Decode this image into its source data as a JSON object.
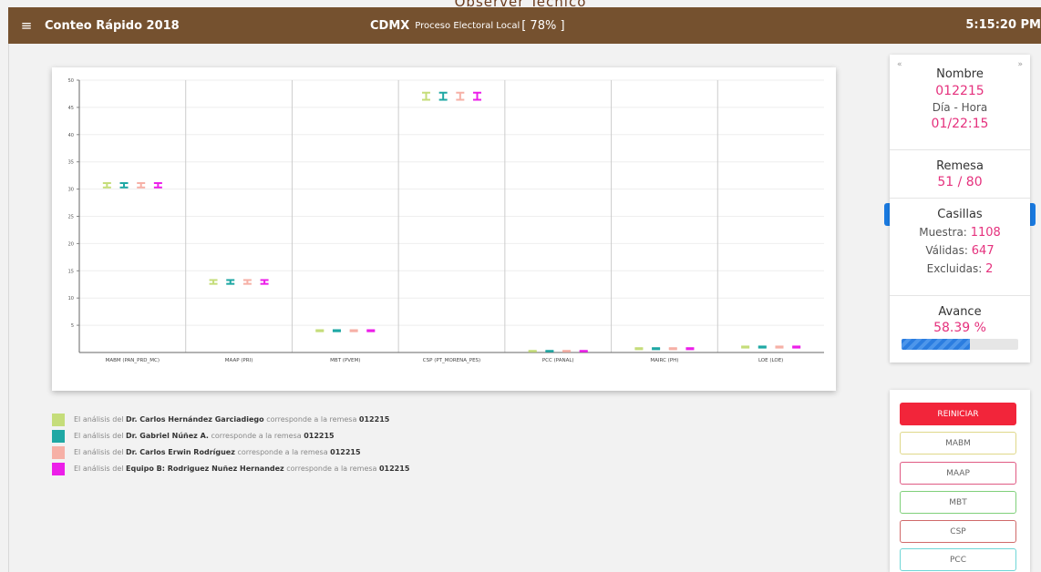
{
  "header": {
    "overhead_title": "Observer Técnico",
    "app_title": "Conteo Rápido 2018",
    "state": "CDMX",
    "process": "Proceso Electoral Local",
    "percent": "[ 78% ]",
    "clock": "5:15:20 PM"
  },
  "colors": {
    "header_bg": "#75512f",
    "accent": "#e5317d",
    "reset": "#f2253a",
    "progress": "#2b7de0"
  },
  "chart_data": {
    "type": "errorbar",
    "categories": [
      "MABM (PAN_PRD_MC)",
      "MAAP (PRI)",
      "MBT (PVEM)",
      "CSP (PT_MORENA_PES)",
      "PCC (PANAL)",
      "MAIRC (PH)",
      "LOE (LOE)"
    ],
    "yticks": [
      5,
      10,
      15,
      20,
      25,
      30,
      35,
      40,
      45,
      50
    ],
    "ylim": [
      0,
      50
    ],
    "grid": true,
    "series": [
      {
        "color": "#c5dd7a",
        "values": [
          [
            30.3,
            31.1
          ],
          [
            12.6,
            13.3
          ],
          [
            3.9,
            4.1
          ],
          [
            46.4,
            47.7
          ],
          [
            0.2,
            0.3
          ],
          [
            0.6,
            0.8
          ],
          [
            0.9,
            1.1
          ]
        ]
      },
      {
        "color": "#1fa8a4",
        "values": [
          [
            30.3,
            31.1
          ],
          [
            12.6,
            13.3
          ],
          [
            3.9,
            4.1
          ],
          [
            46.4,
            47.7
          ],
          [
            0.2,
            0.3
          ],
          [
            0.6,
            0.8
          ],
          [
            0.9,
            1.1
          ]
        ]
      },
      {
        "color": "#f6b0a6",
        "values": [
          [
            30.3,
            31.1
          ],
          [
            12.6,
            13.3
          ],
          [
            3.9,
            4.1
          ],
          [
            46.4,
            47.7
          ],
          [
            0.2,
            0.3
          ],
          [
            0.6,
            0.8
          ],
          [
            0.9,
            1.1
          ]
        ]
      },
      {
        "color": "#ec1fe9",
        "values": [
          [
            30.3,
            31.1
          ],
          [
            12.6,
            13.3
          ],
          [
            3.9,
            4.1
          ],
          [
            46.4,
            47.7
          ],
          [
            0.2,
            0.3
          ],
          [
            0.6,
            0.8
          ],
          [
            0.9,
            1.1
          ]
        ]
      }
    ]
  },
  "legend": [
    {
      "color": "#c5dd7a",
      "prefix": "El análisis del",
      "name": "Dr. Carlos Hernández Garciadiego",
      "middle": "corresponde a la remesa",
      "remesa": "012215"
    },
    {
      "color": "#1fa8a4",
      "prefix": "El análisis del",
      "name": "Dr. Gabriel Núñez A.",
      "middle": "corresponde a la remesa",
      "remesa": "012215"
    },
    {
      "color": "#f6b0a6",
      "prefix": "El análisis del",
      "name": "Dr. Carlos Erwin Rodríguez",
      "middle": "corresponde a la remesa",
      "remesa": "012215"
    },
    {
      "color": "#ec1fe9",
      "prefix": "El análisis del",
      "name": "Equipo B: Rodriguez Nuñez Hernandez",
      "middle": "corresponde a la remesa",
      "remesa": "012215"
    }
  ],
  "info": {
    "prev_glyph": "«",
    "next_glyph": "»",
    "nombre_label": "Nombre",
    "nombre_value": "012215",
    "dia_label": "Día - Hora",
    "dia_value": "01/22:15",
    "remesa_label": "Remesa",
    "remesa_value": "51 / 80",
    "casillas_label": "Casillas",
    "muestra_label": "Muestra:",
    "muestra_value": "1108",
    "validas_label": "Válidas:",
    "validas_value": "647",
    "excluidas_label": "Excluidas:",
    "excluidas_value": "2",
    "avance_label": "Avance",
    "avance_value": "58.39 %",
    "avance_fraction": 0.5839,
    "left_arrow": "◀",
    "right_arrow": "▶"
  },
  "buttons": [
    {
      "label": "REINICIAR",
      "border": "#f2253a"
    },
    {
      "label": "MABM",
      "border": "#dfd88a"
    },
    {
      "label": "MAAP",
      "border": "#e05a83"
    },
    {
      "label": "MBT",
      "border": "#7fd07a"
    },
    {
      "label": "CSP",
      "border": "#d06a6a"
    },
    {
      "label": "PCC",
      "border": "#6fd6d6"
    }
  ]
}
